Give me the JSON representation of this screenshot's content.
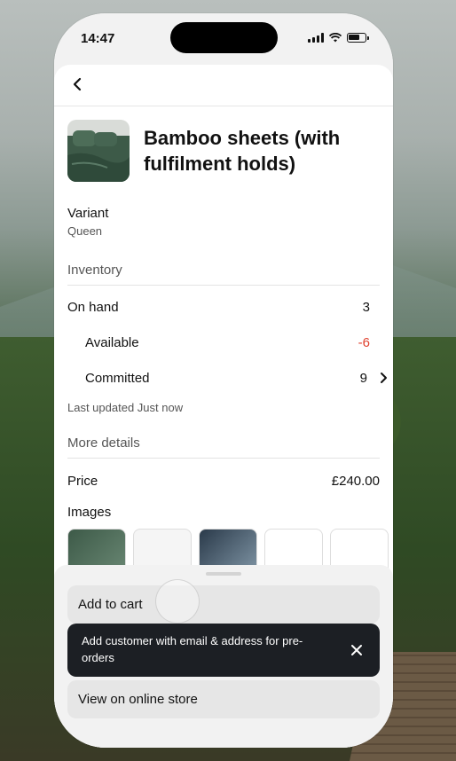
{
  "status_bar": {
    "time": "14:47"
  },
  "product": {
    "title": "Bamboo sheets (with fulfilment holds)"
  },
  "variant": {
    "label": "Variant",
    "value": "Queen"
  },
  "inventory": {
    "heading": "Inventory",
    "on_hand": {
      "label": "On hand",
      "value": "3"
    },
    "available": {
      "label": "Available",
      "value": "-6"
    },
    "committed": {
      "label": "Committed",
      "value": "9"
    },
    "last_updated": "Last updated Just now"
  },
  "more_details": {
    "heading": "More details",
    "price": {
      "label": "Price",
      "value": "£240.00"
    },
    "images_label": "Images"
  },
  "actions": {
    "add_to_cart": "Add to cart",
    "view_online": "View on online store"
  },
  "toast": {
    "message": "Add customer with email & address for pre-orders"
  },
  "colors": {
    "negative": "#e0422f",
    "toast_bg": "#1c1f24"
  }
}
